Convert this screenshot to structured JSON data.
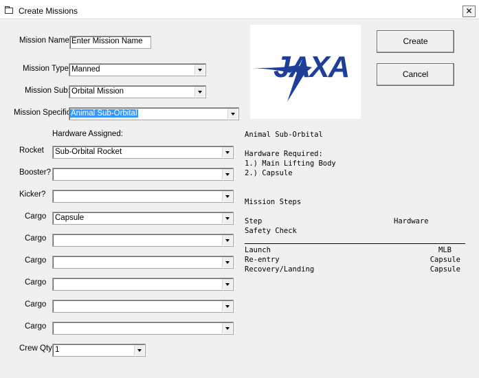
{
  "window": {
    "title": "Create Missions",
    "close_glyph": "✕"
  },
  "form": {
    "mission_name": {
      "label": "Mission Name:",
      "value": "Enter Mission Name"
    },
    "mission_type": {
      "label": "Mission Type:",
      "value": "Manned"
    },
    "mission_sub": {
      "label": "Mission Sub:",
      "value": "Orbital Mission"
    },
    "mission_specific": {
      "label": "Mission Specific:",
      "value": "Animal Sub-Orbital"
    },
    "hardware_heading": "Hardware Assigned:",
    "rocket": {
      "label": "Rocket",
      "value": "Sub-Orbital Rocket"
    },
    "booster": {
      "label": "Booster?",
      "value": ""
    },
    "kicker": {
      "label": "Kicker?",
      "value": ""
    },
    "cargo": [
      {
        "label": "Cargo",
        "value": "Capsule"
      },
      {
        "label": "Cargo",
        "value": ""
      },
      {
        "label": "Cargo",
        "value": ""
      },
      {
        "label": "Cargo",
        "value": ""
      },
      {
        "label": "Cargo",
        "value": ""
      },
      {
        "label": "Cargo",
        "value": ""
      }
    ],
    "crew_qty": {
      "label": "Crew Qty",
      "value": "1"
    }
  },
  "buttons": {
    "create": "Create",
    "cancel": "Cancel"
  },
  "logo": {
    "text": "JAXA",
    "color": "#1d3f97"
  },
  "details": {
    "title": "Animal Sub-Orbital",
    "hardware_required_heading": "Hardware Required:",
    "hardware_required": [
      "1.) Main Lifting Body",
      "2.) Capsule"
    ],
    "mission_steps_heading": "Mission Steps",
    "col_step": "Step",
    "col_hardware": "Hardware",
    "pre_step": "Safety Check",
    "steps": [
      {
        "step": "Launch",
        "hardware": "MLB"
      },
      {
        "step": "Re-entry",
        "hardware": "Capsule"
      },
      {
        "step": "Recovery/Landing",
        "hardware": "Capsule"
      }
    ]
  }
}
